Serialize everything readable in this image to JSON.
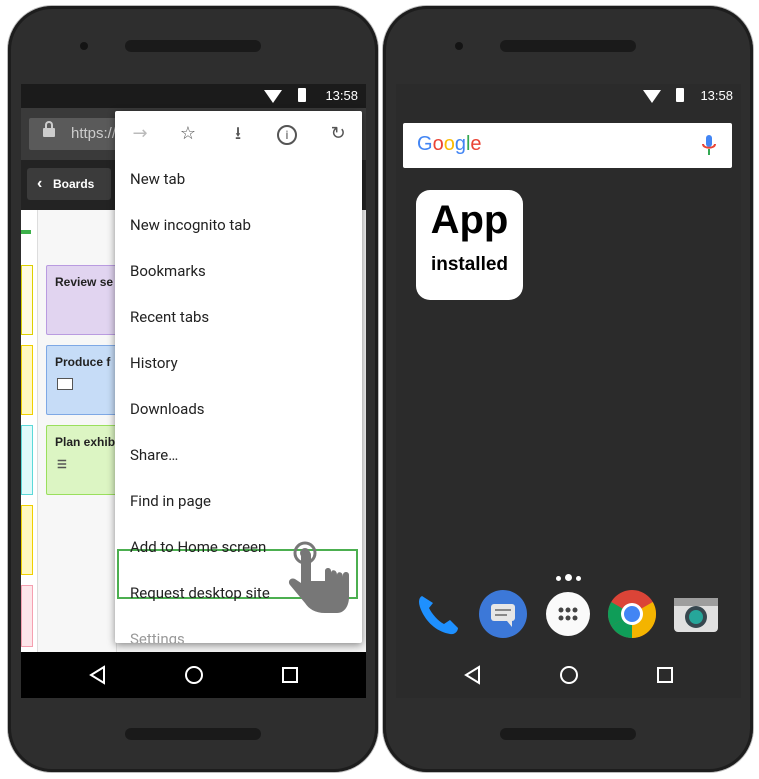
{
  "left_phone": {
    "status": {
      "time": "13:58"
    },
    "browser": {
      "url": "https://",
      "boards_label": "Boards",
      "cards": [
        "Review se",
        "Produce f",
        "Plan exhib"
      ]
    },
    "menu": {
      "items": [
        {
          "label": "New tab"
        },
        {
          "label": "New incognito tab"
        },
        {
          "label": "Bookmarks"
        },
        {
          "label": "Recent tabs"
        },
        {
          "label": "History"
        },
        {
          "label": "Downloads"
        },
        {
          "label": "Share…"
        },
        {
          "label": "Find in page"
        },
        {
          "label": "Add to Home screen"
        },
        {
          "label": "Request desktop site"
        },
        {
          "label": "Settings"
        }
      ]
    }
  },
  "right_phone": {
    "status": {
      "time": "13:58"
    },
    "search": {
      "logo": "Google"
    },
    "app_icon": {
      "line1": "App",
      "line2": "installed"
    },
    "dock_icons": [
      "phone-icon",
      "messages-icon",
      "apps-drawer-icon",
      "chrome-icon",
      "camera-icon"
    ]
  },
  "colors": {
    "highlight": "#4caf50",
    "phone_body": "#2e2e2e",
    "card_purple": "#e1d4f0",
    "card_blue": "#c6dcf7",
    "card_green": "#dcf5c3"
  }
}
